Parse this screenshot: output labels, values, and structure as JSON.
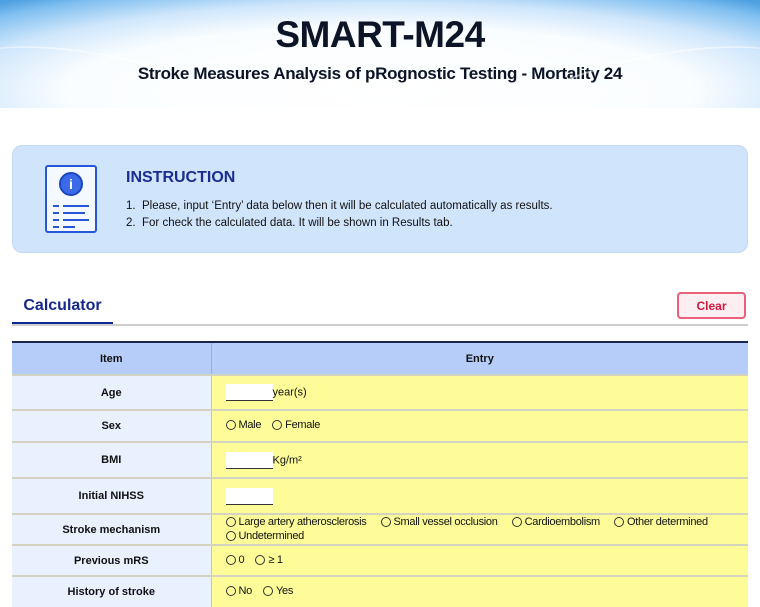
{
  "header": {
    "title": "SMART-M24",
    "subtitle": "Stroke Measures Analysis of pRognostic Testing - Mortality 24"
  },
  "instruction": {
    "heading": "INSTRUCTION",
    "items": [
      {
        "n": "1.",
        "text": "Please, input ‘Entry’ data below then it will be calculated automatically as results."
      },
      {
        "n": "2.",
        "text": "For check the calculated data. It will be shown in Results tab."
      }
    ]
  },
  "tabs": {
    "calculator": "Calculator"
  },
  "clear_label": "Clear",
  "table": {
    "headers": [
      "Item",
      "Entry"
    ],
    "rows": {
      "age": {
        "label": "Age",
        "unit": "year(s)",
        "value": ""
      },
      "sex": {
        "label": "Sex",
        "options": [
          "Male",
          "Female"
        ]
      },
      "bmi": {
        "label": "BMI",
        "unit": "Kg/m²",
        "value": ""
      },
      "nihss": {
        "label": "Initial NIHSS",
        "value": ""
      },
      "mechanism": {
        "label": "Stroke mechanism",
        "options": [
          "Large artery atherosclerosis",
          "Small vessel occlusion",
          "Cardioembolism",
          "Other determined",
          "Undetermined"
        ]
      },
      "mrs": {
        "label": "Previous mRS",
        "options": [
          "0",
          "≥ 1"
        ]
      },
      "history": {
        "label": "History of stroke",
        "options": [
          "No",
          "Yes"
        ]
      }
    }
  }
}
